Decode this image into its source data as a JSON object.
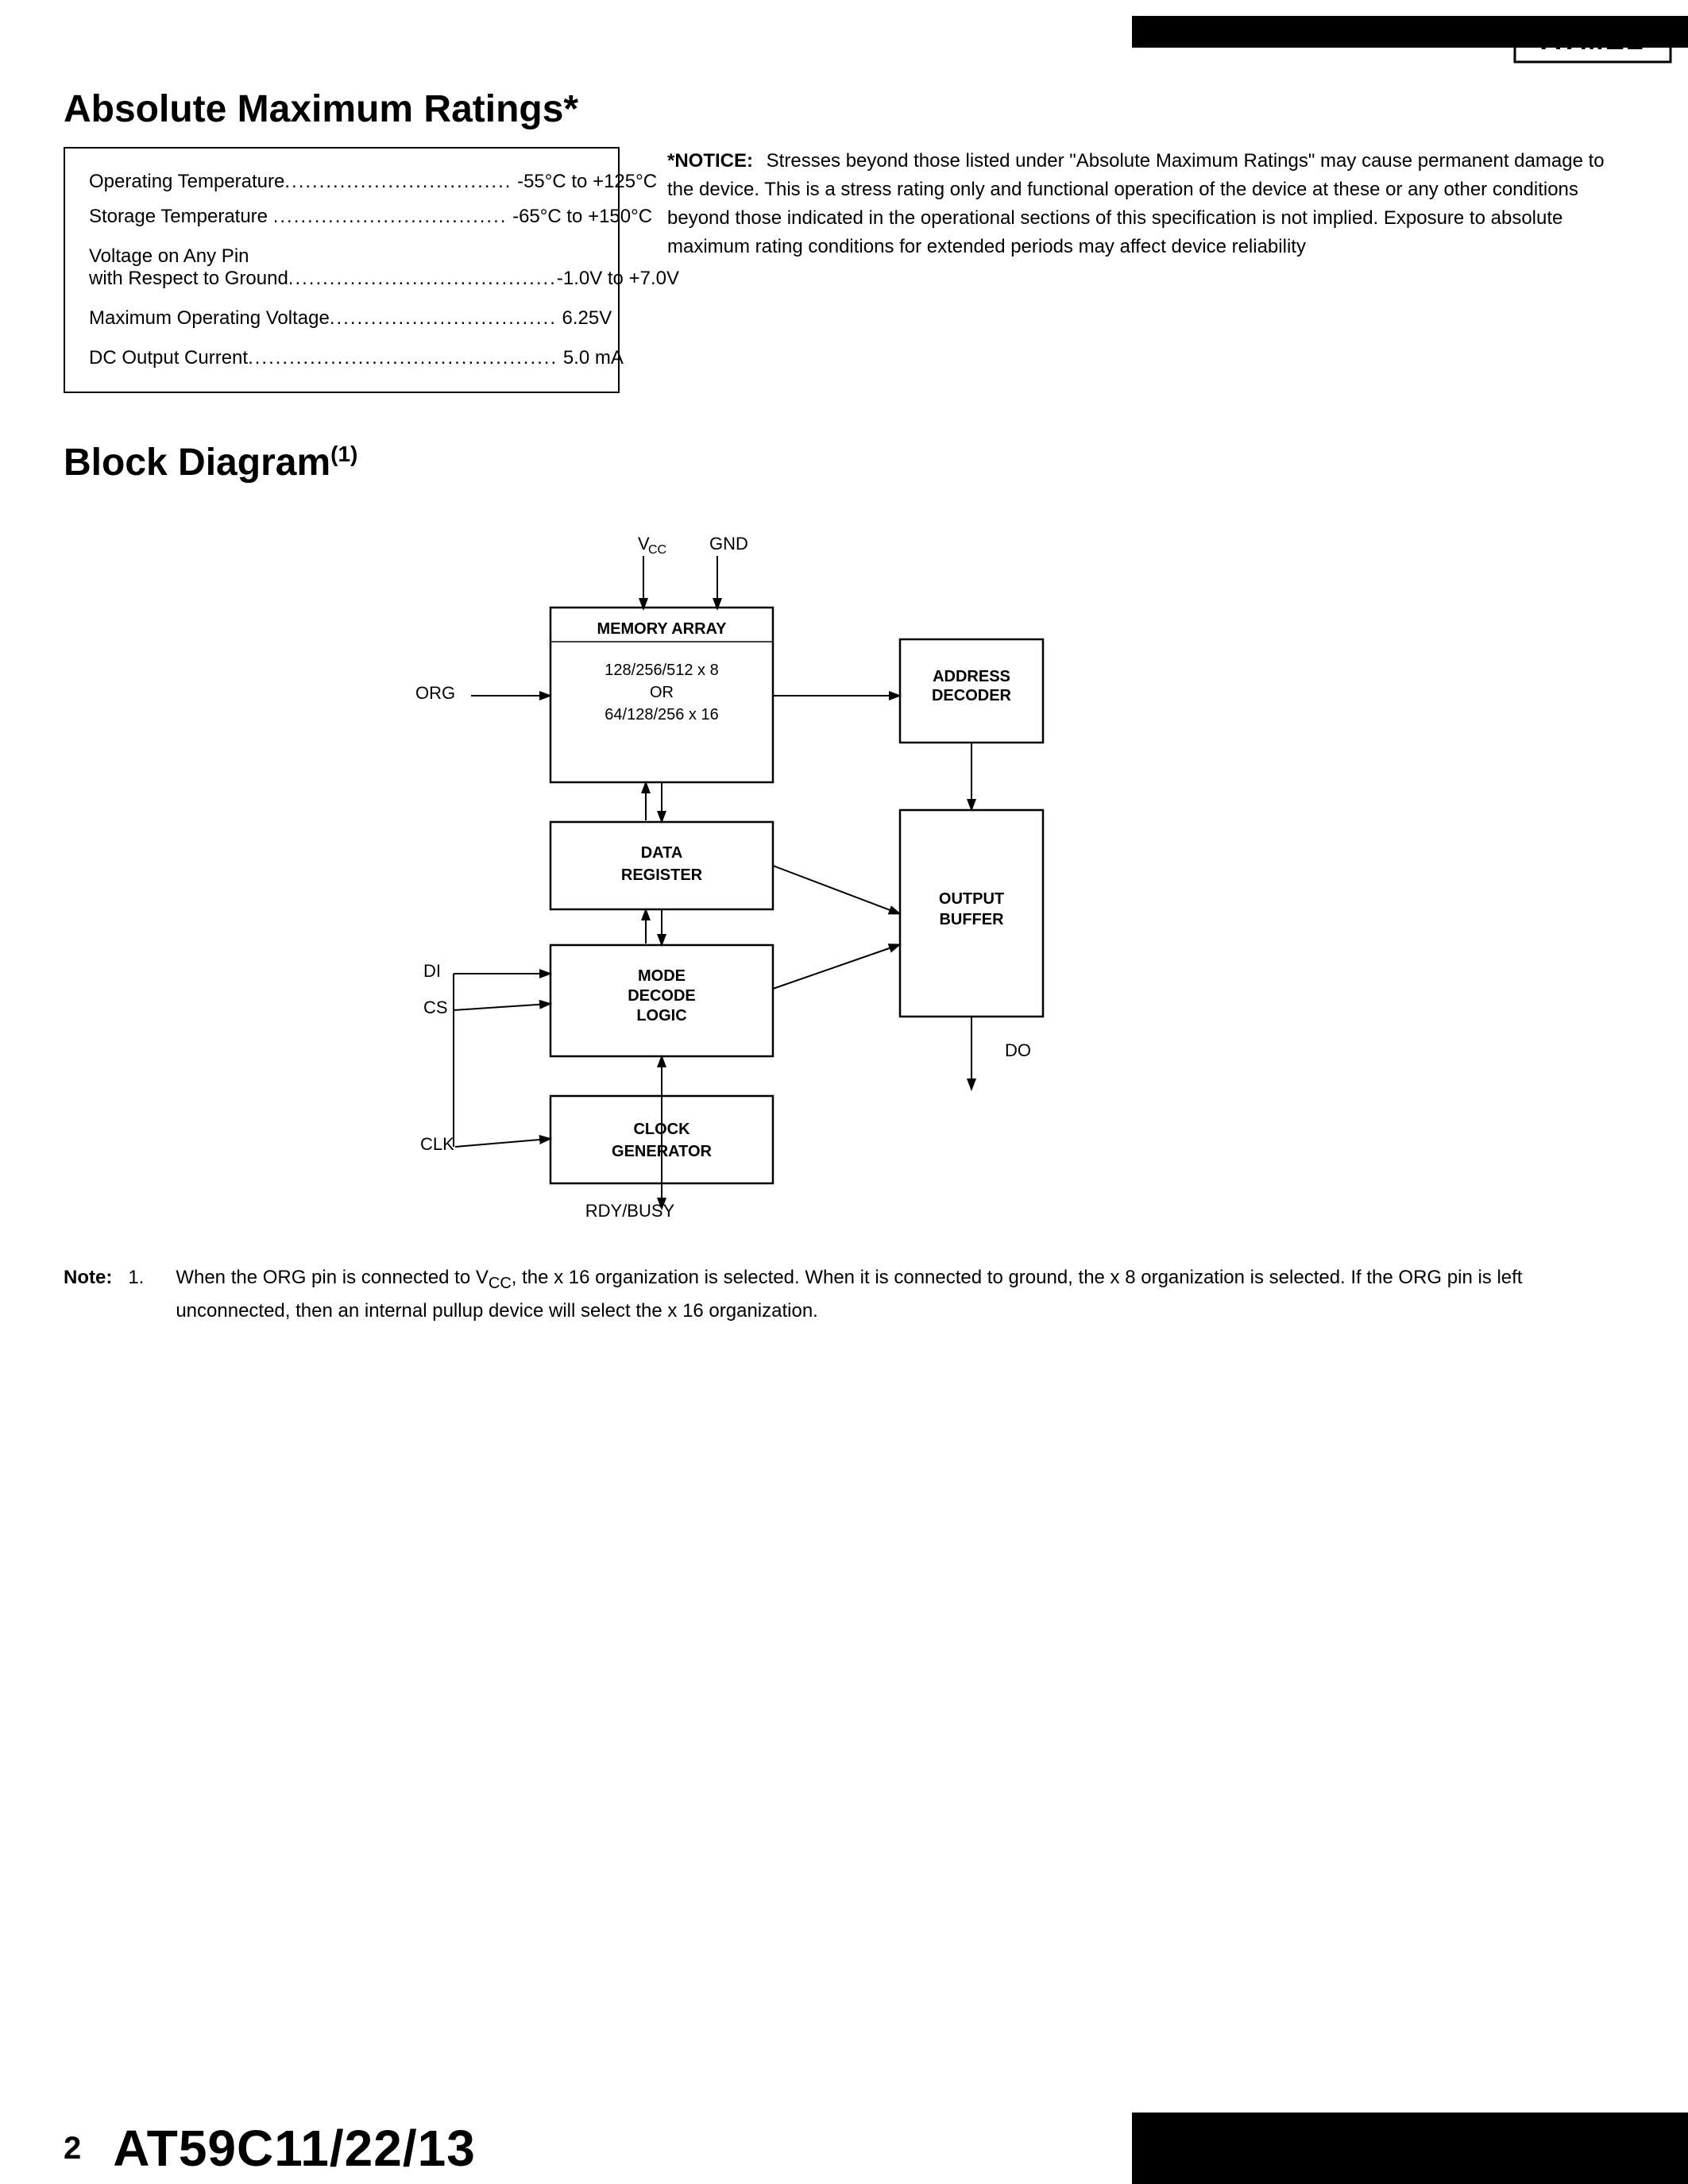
{
  "header": {
    "logo_alt": "ATMEL Logo"
  },
  "abs_max": {
    "title": "Absolute Maximum Ratings*",
    "rows": [
      {
        "label": "Operating Temperature",
        "dots": ".................................",
        "value": "-55°C to +125°C"
      },
      {
        "label": "Storage Temperature",
        "dots": "..................................",
        "value": "-65°C to +150°C"
      },
      {
        "label": "Voltage on Any Pin\nwith Respect to Ground",
        "dots": "......................................",
        "value": "-1.0V to +7.0V"
      },
      {
        "label": "Maximum Operating Voltage",
        "dots": "........................................",
        "value": "6.25V"
      },
      {
        "label": "DC Output Current",
        "dots": ".............................................",
        "value": "5.0 mA"
      }
    ],
    "notice_label": "*NOTICE:",
    "notice_text": "Stresses beyond those listed under \"Absolute Maximum Ratings\" may cause permanent damage to the device. This is a stress rating only and functional operation of the device at these or any other conditions beyond those indicated in the operational sections of this specification is not implied. Exposure to absolute maximum rating conditions for extended periods may affect device reliability"
  },
  "block_diagram": {
    "title": "Block Diagram",
    "superscript": "(1)",
    "labels": {
      "vcc": "V",
      "vcc_sub": "CC",
      "gnd": "GND",
      "org": "ORG",
      "di": "DI",
      "cs": "CS",
      "clk": "CLK",
      "do": "DO",
      "rdy_busy": "RDY/BUSY",
      "memory_array": "MEMORY ARRAY",
      "memory_org": "128/256/512 x 8",
      "memory_or": "OR",
      "memory_org2": "64/128/256 x 16",
      "address_decoder": "ADDRESS\nDECODER",
      "data_register": "DATA\nREGISTER",
      "mode_decode": "MODE\nDECODE\nLOGIC",
      "clock_generator": "CLOCK\nGENERATOR",
      "output_buffer": "OUTPUT\nBUFFER"
    }
  },
  "note": {
    "label": "Note:",
    "number": "1.",
    "text": "When the ORG pin is connected to V"
  },
  "note_full": "When the ORG pin is connected to VCC, the x 16 organization is selected. When it is connected to ground, the x 8 organization is selected. If the ORG pin is left unconnected, then an internal pullup device will select the x 16 organization.",
  "footer": {
    "page": "2",
    "title": "AT59C11/22/13"
  }
}
